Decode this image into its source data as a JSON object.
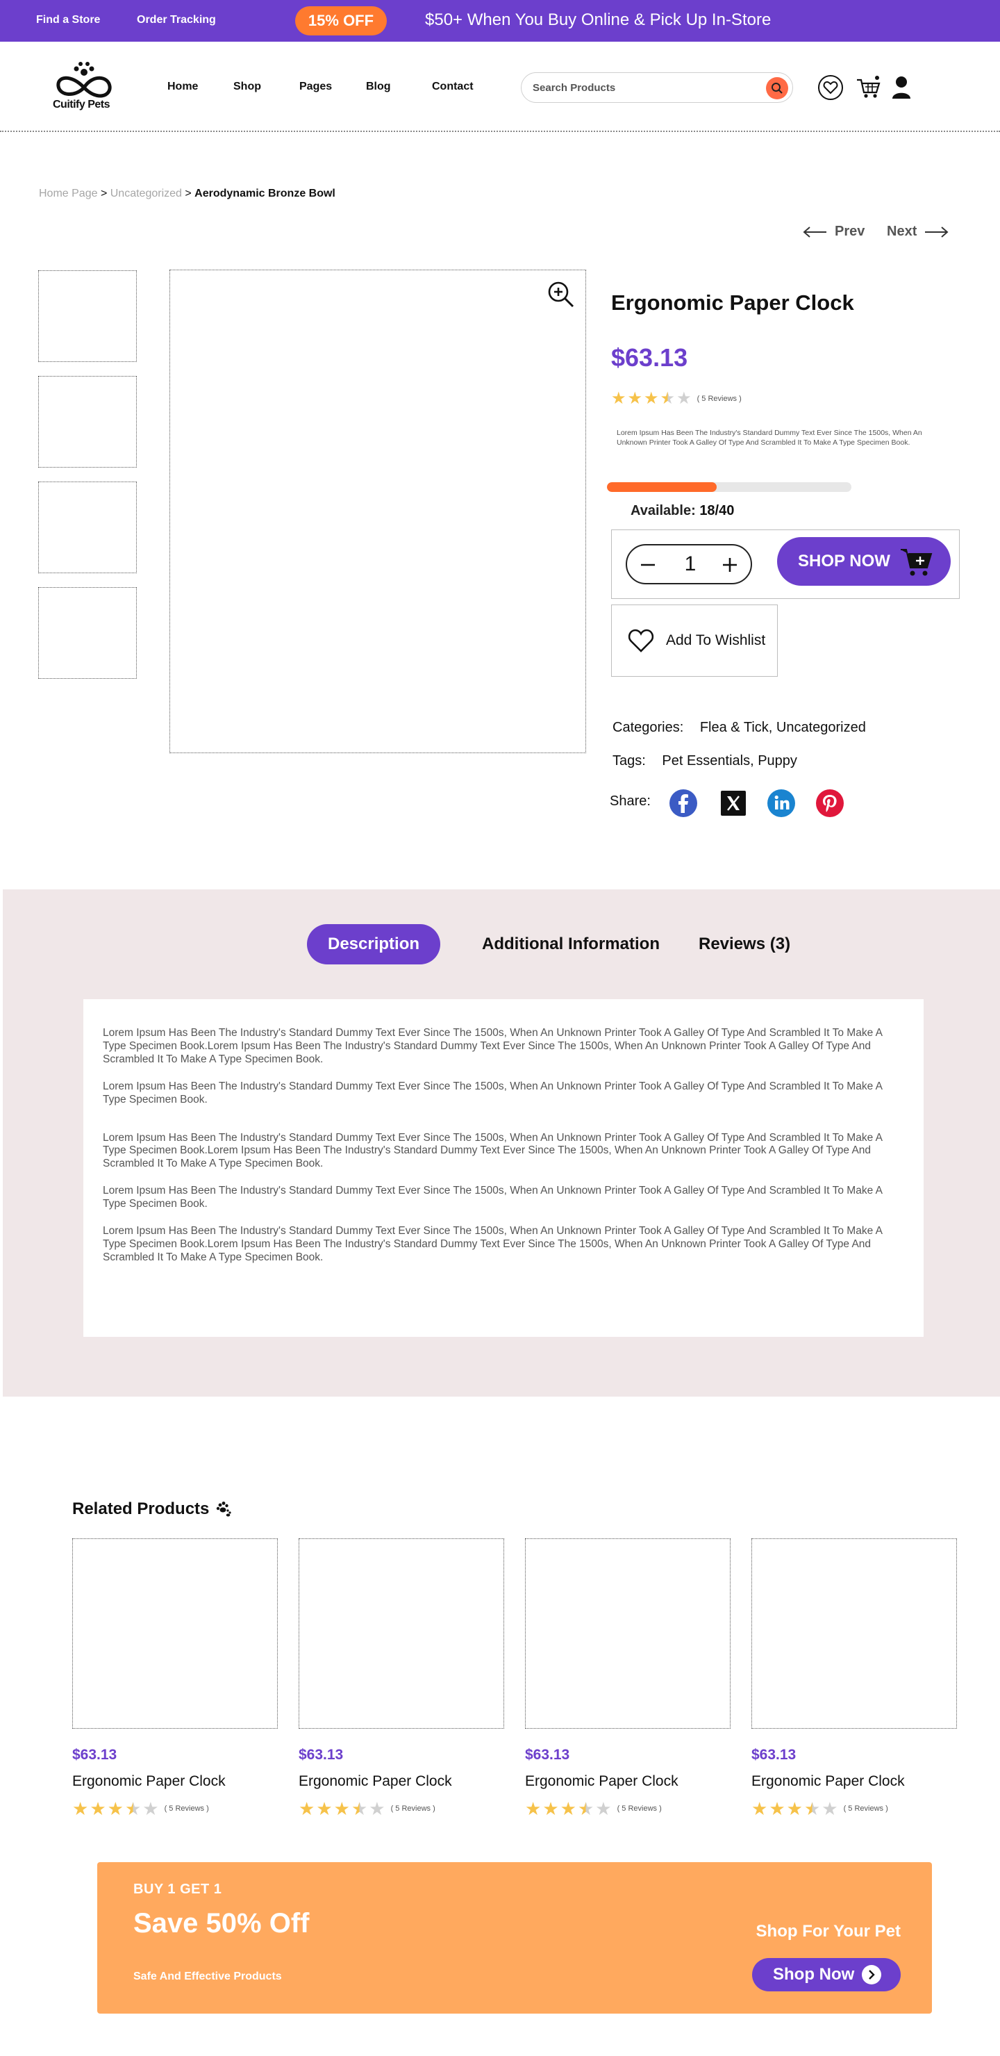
{
  "topbar": {
    "find_store": "Find a Store",
    "order_tracking": "Order Tracking",
    "promo_badge": "15% OFF",
    "promo_text": "$50+ When You Buy Online & Pick Up In-Store"
  },
  "header": {
    "logo_text": "Cuitify Pets",
    "nav": [
      "Home",
      "Shop",
      "Pages",
      "Blog",
      "Contact"
    ],
    "search_placeholder": "Search Products",
    "icons": [
      "heart-icon",
      "cart-icon",
      "user-icon"
    ]
  },
  "breadcrumb": {
    "home": "Home Page",
    "category": "Uncategorized",
    "current": "Aerodynamic Bronze Bowl",
    "separator": ">"
  },
  "pager": {
    "prev": "Prev",
    "next": "Next"
  },
  "product": {
    "title": "Ergonomic Paper Clock",
    "price": "$63.13",
    "rating": 3.5,
    "rating_max": 5,
    "reviews_text": "( 5 Reviews )",
    "description": "Lorem Ipsum Has Been The Industry's Standard Dummy Text Ever Since The 1500s, When An Unknown Printer Took A Galley Of Type And Scrambled It To Make A Type Specimen Book.",
    "stock_fraction": 0.45,
    "available_label": "Available:",
    "available_value": "18/40",
    "quantity": "1",
    "shop_now": "SHOP NOW",
    "wishlist": "Add To Wishlist",
    "categories_label": "Categories:",
    "categories_value": "Flea & Tick, Uncategorized",
    "tags_label": "Tags:",
    "tags_value": "Pet Essentials, Puppy",
    "share_label": "Share:"
  },
  "tabs": {
    "items": [
      "Description",
      "Additional Information",
      "Reviews (3)"
    ],
    "active": "Description",
    "paragraphs": [
      "Lorem Ipsum Has Been The Industry's Standard Dummy Text Ever Since The 1500s, When An Unknown Printer Took A Galley Of Type And Scrambled It To Make A Type Specimen Book.Lorem Ipsum Has Been The Industry's Standard Dummy Text Ever Since The 1500s, When An Unknown Printer Took A Galley Of Type And Scrambled It To Make A Type Specimen Book.",
      "Lorem Ipsum Has Been The Industry's Standard Dummy Text Ever Since The 1500s, When An Unknown Printer Took A Galley Of Type And Scrambled It To Make A Type Specimen Book.",
      "Lorem Ipsum Has Been The Industry's Standard Dummy Text Ever Since The 1500s, When An Unknown Printer Took A Galley Of Type And Scrambled It To Make A Type Specimen Book.Lorem Ipsum Has Been The Industry's Standard Dummy Text Ever Since The 1500s, When An Unknown Printer Took A Galley Of Type And Scrambled It To Make A Type Specimen Book.",
      "Lorem Ipsum Has Been The Industry's Standard Dummy Text Ever Since The 1500s, When An Unknown Printer Took A Galley Of Type And Scrambled It To Make A Type Specimen Book.",
      "Lorem Ipsum Has Been The Industry's Standard Dummy Text Ever Since The 1500s, When An Unknown Printer Took A Galley Of Type And Scrambled It To Make A Type Specimen Book.Lorem Ipsum Has Been The Industry's Standard Dummy Text Ever Since The 1500s, When An Unknown Printer Took A Galley Of Type And Scrambled It To Make A Type Specimen Book."
    ]
  },
  "related": {
    "title": "Related Products",
    "items": [
      {
        "price": "$63.13",
        "name": "Ergonomic Paper Clock",
        "rating": 3.5,
        "reviews": "( 5 Reviews )"
      },
      {
        "price": "$63.13",
        "name": "Ergonomic Paper Clock",
        "rating": 3.5,
        "reviews": "( 5 Reviews )"
      },
      {
        "price": "$63.13",
        "name": "Ergonomic Paper Clock",
        "rating": 3.5,
        "reviews": "( 5 Reviews )"
      },
      {
        "price": "$63.13",
        "name": "Ergonomic Paper Clock",
        "rating": 3.5,
        "reviews": "( 5 Reviews )"
      }
    ]
  },
  "banner": {
    "eyebrow": "BUY 1 GET 1",
    "title": "Save 50% Off",
    "subtitle": "Safe And Effective Products",
    "right_text": "Shop For Your Pet",
    "button": "Shop Now"
  },
  "colors": {
    "brand_purple": "#6c3fcc",
    "accent_orange": "#ff7a2f",
    "progress_orange": "#ff6a2a",
    "banner_orange": "#ffa95e",
    "tabs_bg": "#f0e7e8",
    "star": "#f6c24a"
  }
}
